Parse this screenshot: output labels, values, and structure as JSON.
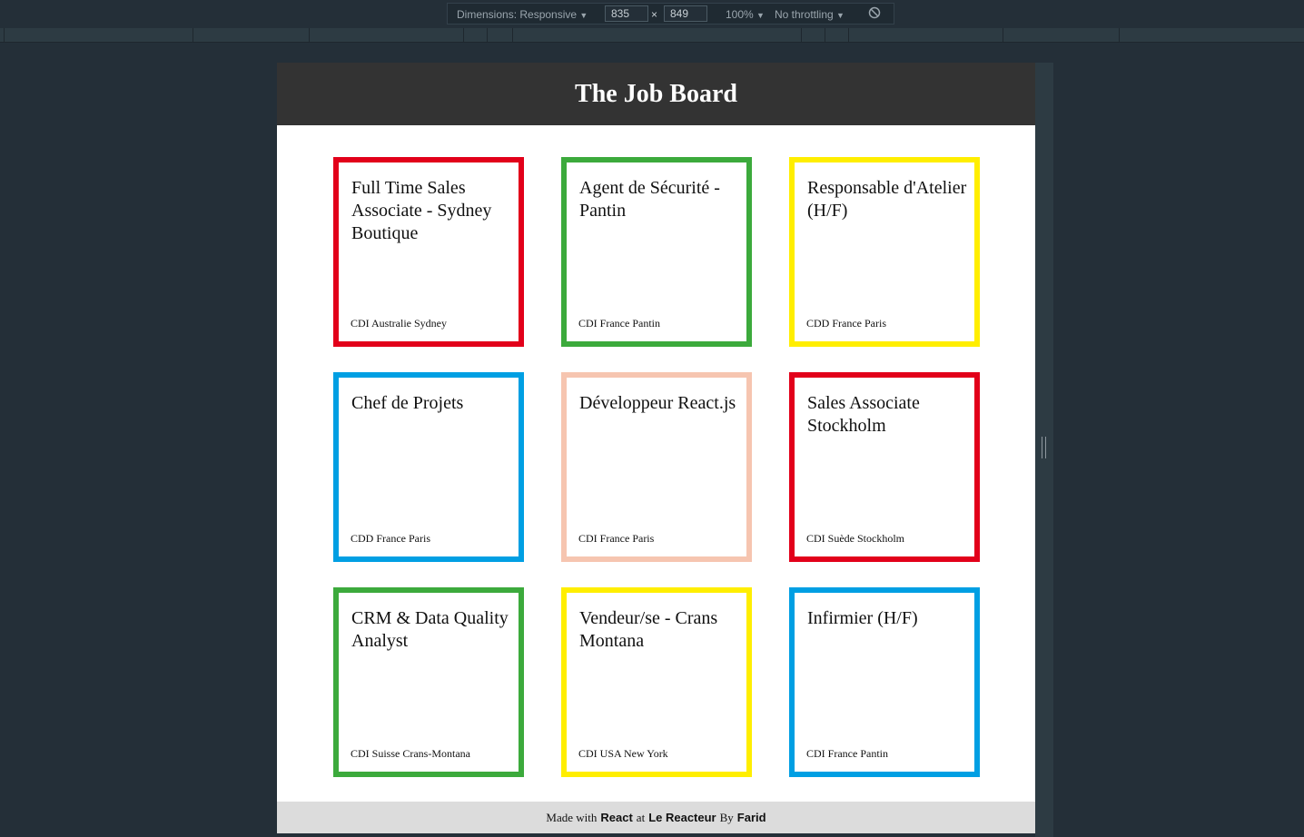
{
  "devtools": {
    "dimensions_label": "Dimensions: Responsive",
    "width": "835",
    "times": "×",
    "height": "849",
    "zoom": "100%",
    "throttling": "No throttling",
    "dropdown_glyph": "▼",
    "rotate_glyph": "⃠"
  },
  "app": {
    "title": "The Job Board"
  },
  "jobs": [
    {
      "title": "Full Time Sales Associate - Sydney Boutique",
      "meta": "CDI Australie Sydney",
      "color": "#e2001a"
    },
    {
      "title": "Agent de Sécurité - Pantin",
      "meta": "CDI France Pantin",
      "color": "#3caa3c"
    },
    {
      "title": "Responsable d'Atelier (H/F)",
      "meta": "CDD France Paris",
      "color": "#ffee00"
    },
    {
      "title": "Chef de Projets",
      "meta": "CDD France Paris",
      "color": "#009fe3"
    },
    {
      "title": "Développeur React.js",
      "meta": "CDI France Paris",
      "color": "#f6c5b0"
    },
    {
      "title": "Sales Associate Stockholm",
      "meta": "CDI Suède Stockholm",
      "color": "#e2001a"
    },
    {
      "title": "CRM & Data Quality Analyst",
      "meta": "CDI Suisse Crans-Montana",
      "color": "#3caa3c"
    },
    {
      "title": "Vendeur/se - Crans Montana",
      "meta": "CDI USA New York",
      "color": "#ffee00"
    },
    {
      "title": "Infirmier (H/F)",
      "meta": "CDI France Pantin",
      "color": "#009fe3"
    }
  ],
  "footer": {
    "made_with": "Made with",
    "react": "React",
    "at": "at",
    "school": "Le Reacteur",
    "by": "By",
    "author": "Farid"
  }
}
